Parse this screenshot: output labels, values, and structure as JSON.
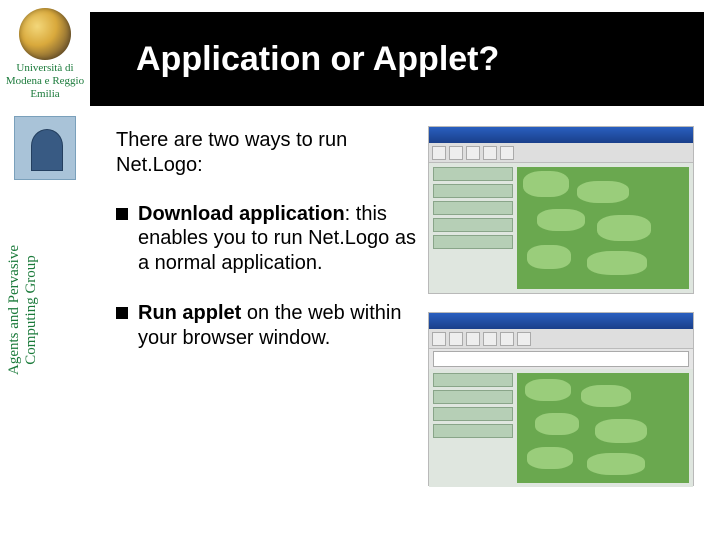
{
  "sidebar": {
    "university": "Università di Modena e Reggio Emilia",
    "group_l1": "Agents and Pervasive",
    "group_l2": "Computing Group"
  },
  "title": "Application or Applet?",
  "intro": "There are two ways to run Net.Logo:",
  "bullets": [
    {
      "bold": "Download application",
      "rest": ": this enables you to run Net.Logo as a normal application."
    },
    {
      "bold": "Run applet",
      "rest": " on the web within your browser window."
    }
  ]
}
